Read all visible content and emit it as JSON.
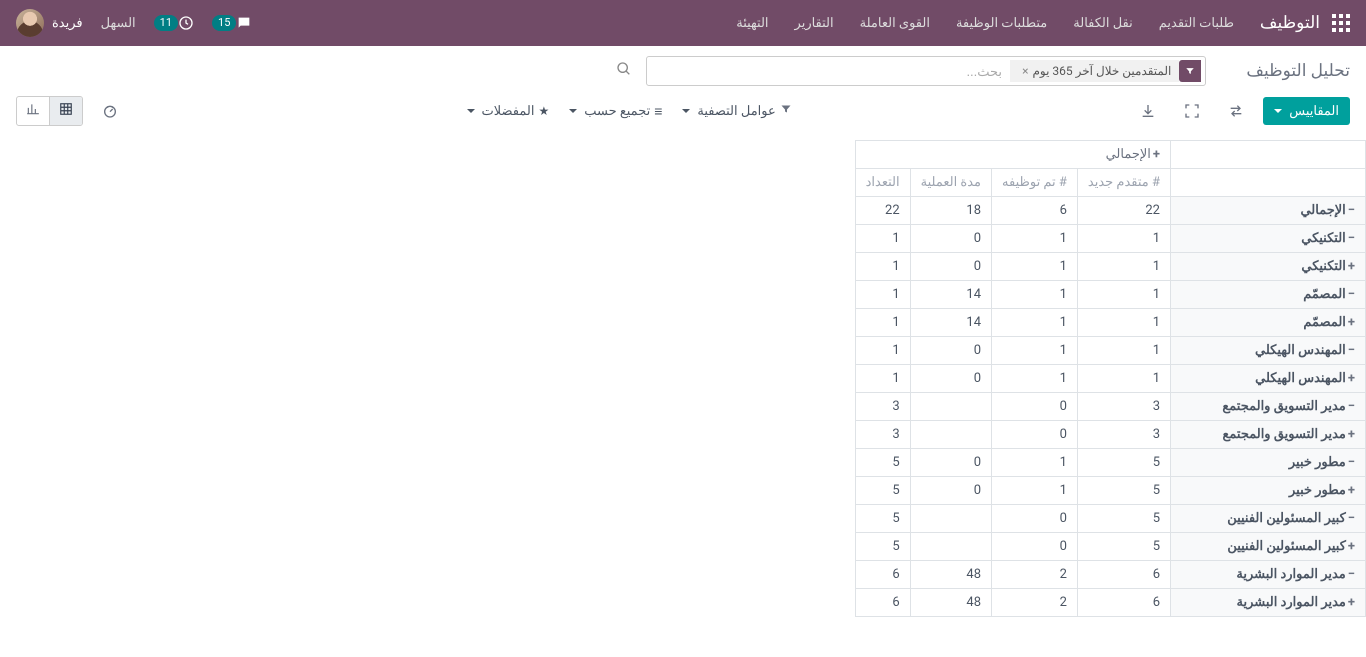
{
  "navbar": {
    "brand": "التوظيف",
    "links": [
      "طلبات التقديم",
      "نقل الكفالة",
      "متطلبات الوظيفة",
      "القوى العاملة",
      "التهيئة",
      "التقارير"
    ],
    "chat_count": "15",
    "activity_count": "11",
    "easy_label": "السهل",
    "user_name": "فريدة"
  },
  "header": {
    "title": "تحليل التوظيف",
    "facet_label": "المتقدمين خلال آخر 365 يوم",
    "search_placeholder": "بحث..."
  },
  "toolbar": {
    "measures": "المقاييس",
    "filters": "عوامل التصفية",
    "groupby": "تجميع حسب",
    "favorites": "المفضلات"
  },
  "pivot": {
    "grand_total": "الإجمالي",
    "metrics": [
      "# متقدم جديد",
      "# تم توظيفه",
      "مدة العملية",
      "التعداد"
    ],
    "total_row": {
      "label": "الإجمالي",
      "vals": [
        "22",
        "6",
        "18",
        "22"
      ]
    },
    "rows": [
      {
        "label": "التكنيكي",
        "sign": "-",
        "vals": [
          "1",
          "1",
          "0",
          "1"
        ]
      },
      {
        "label": "التكنيكي",
        "sign": "+",
        "vals": [
          "1",
          "1",
          "0",
          "1"
        ]
      },
      {
        "label": "المصمّم",
        "sign": "-",
        "vals": [
          "1",
          "1",
          "14",
          "1"
        ]
      },
      {
        "label": "المصمّم",
        "sign": "+",
        "vals": [
          "1",
          "1",
          "14",
          "1"
        ]
      },
      {
        "label": "المهندس الهيكلي",
        "sign": "-",
        "vals": [
          "1",
          "1",
          "0",
          "1"
        ]
      },
      {
        "label": "المهندس الهيكلي",
        "sign": "+",
        "vals": [
          "1",
          "1",
          "0",
          "1"
        ]
      },
      {
        "label": "مدير التسويق والمجتمع",
        "sign": "-",
        "vals": [
          "3",
          "0",
          "",
          "3"
        ]
      },
      {
        "label": "مدير التسويق والمجتمع",
        "sign": "+",
        "vals": [
          "3",
          "0",
          "",
          "3"
        ]
      },
      {
        "label": "مطور خبير",
        "sign": "-",
        "vals": [
          "5",
          "1",
          "0",
          "5"
        ]
      },
      {
        "label": "مطور خبير",
        "sign": "+",
        "vals": [
          "5",
          "1",
          "0",
          "5"
        ]
      },
      {
        "label": "كبير المسئولين الفنيين",
        "sign": "-",
        "vals": [
          "5",
          "0",
          "",
          "5"
        ]
      },
      {
        "label": "كبير المسئولين الفنيين",
        "sign": "+",
        "vals": [
          "5",
          "0",
          "",
          "5"
        ]
      },
      {
        "label": "مدير الموارد البشرية",
        "sign": "-",
        "vals": [
          "6",
          "2",
          "48",
          "6"
        ]
      },
      {
        "label": "مدير الموارد البشرية",
        "sign": "+",
        "vals": [
          "6",
          "2",
          "48",
          "6"
        ]
      }
    ]
  }
}
